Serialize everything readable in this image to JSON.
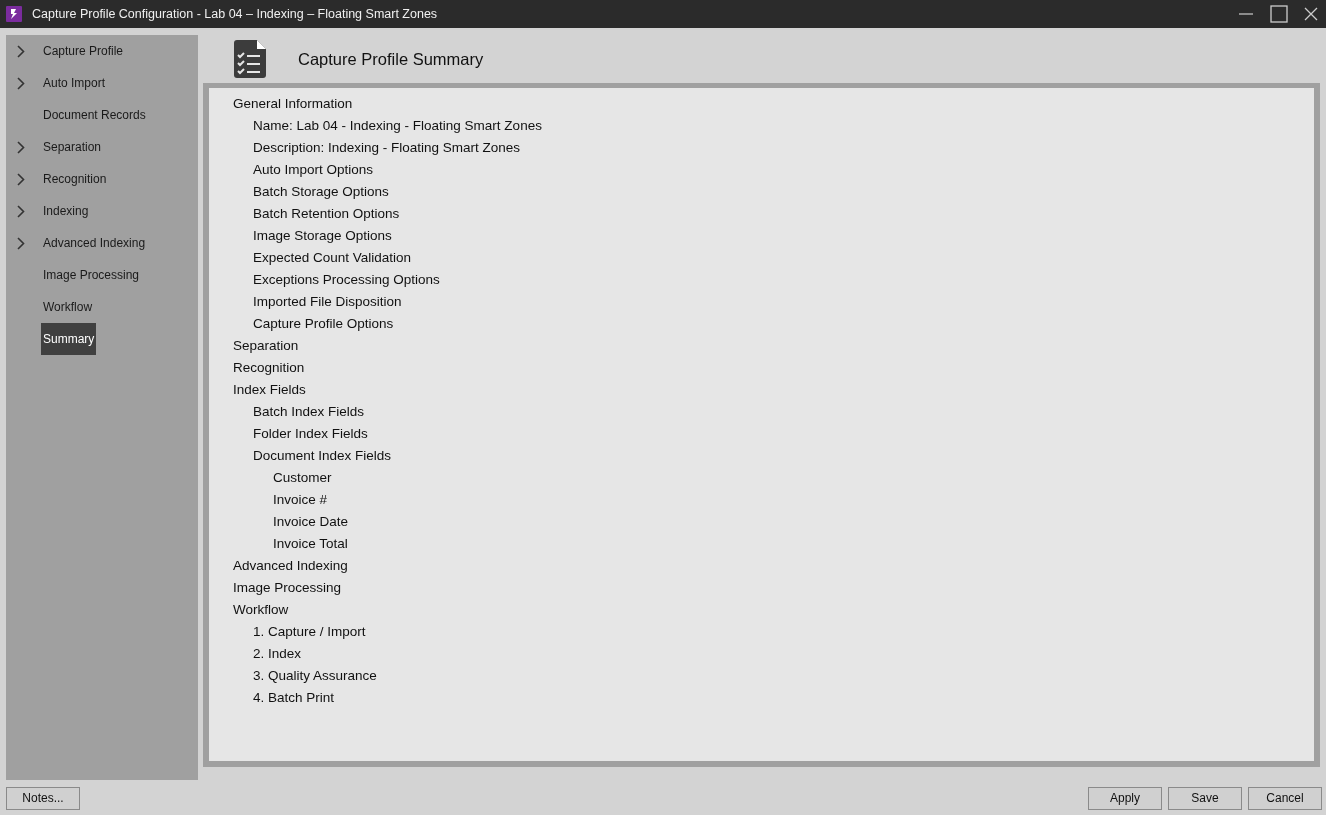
{
  "window": {
    "title": "Capture Profile Configuration - Lab 04 – Indexing – Floating Smart Zones"
  },
  "sidebar": {
    "items": [
      {
        "label": "Capture Profile",
        "expandable": true,
        "selected": false
      },
      {
        "label": "Auto Import",
        "expandable": true,
        "selected": false
      },
      {
        "label": "Document Records",
        "expandable": false,
        "selected": false
      },
      {
        "label": "Separation",
        "expandable": true,
        "selected": false
      },
      {
        "label": "Recognition",
        "expandable": true,
        "selected": false
      },
      {
        "label": "Indexing",
        "expandable": true,
        "selected": false
      },
      {
        "label": "Advanced Indexing",
        "expandable": true,
        "selected": false
      },
      {
        "label": "Image Processing",
        "expandable": false,
        "selected": false
      },
      {
        "label": "Workflow",
        "expandable": false,
        "selected": false
      },
      {
        "label": "Summary",
        "expandable": false,
        "selected": true
      }
    ]
  },
  "header": {
    "title": "Capture Profile Summary"
  },
  "summary": {
    "tree": [
      {
        "label": "General Information",
        "children": [
          {
            "label": "Name: Lab 04 - Indexing - Floating Smart Zones"
          },
          {
            "label": "Description: Indexing - Floating Smart Zones"
          },
          {
            "label": "Auto Import Options"
          },
          {
            "label": "Batch Storage Options"
          },
          {
            "label": "Batch Retention Options"
          },
          {
            "label": "Image Storage Options"
          },
          {
            "label": "Expected Count Validation"
          },
          {
            "label": "Exceptions Processing Options"
          },
          {
            "label": "Imported File Disposition"
          },
          {
            "label": "Capture Profile Options"
          }
        ]
      },
      {
        "label": "Separation"
      },
      {
        "label": "Recognition"
      },
      {
        "label": "Index Fields",
        "children": [
          {
            "label": "Batch Index Fields"
          },
          {
            "label": "Folder Index Fields"
          },
          {
            "label": "Document Index Fields",
            "children": [
              {
                "label": "Customer"
              },
              {
                "label": "Invoice #"
              },
              {
                "label": "Invoice Date"
              },
              {
                "label": "Invoice Total"
              }
            ]
          }
        ]
      },
      {
        "label": "Advanced Indexing"
      },
      {
        "label": "Image Processing"
      },
      {
        "label": "Workflow",
        "children": [
          {
            "label": "1. Capture / Import"
          },
          {
            "label": "2. Index"
          },
          {
            "label": "3. Quality Assurance"
          },
          {
            "label": "4. Batch Print"
          }
        ]
      }
    ]
  },
  "footer": {
    "left_buttons": [
      "Notes..."
    ],
    "right_buttons": [
      "Apply",
      "Save",
      "Cancel"
    ]
  }
}
